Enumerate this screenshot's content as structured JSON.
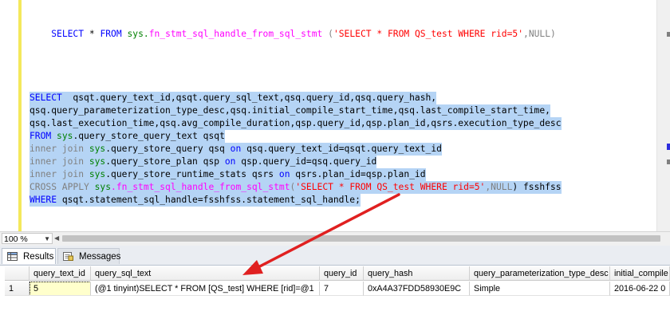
{
  "editor": {
    "line_top": {
      "kw_select": "SELECT",
      "star": " * ",
      "kw_from": "FROM",
      "sp": " ",
      "sys": "sys.",
      "fn": "fn_stmt_sql_handle_from_sql_stmt",
      "open": " (",
      "str": "'SELECT * FROM QS_test WHERE rid=5'",
      "comma": ",",
      "null": "NULL",
      "close": ")"
    },
    "query_lines": [
      {
        "a": "SELECT",
        "b": "  qsqt.query_text_id,qsqt.query_sql_text,qsq.query_id,qsq.query_hash,"
      },
      {
        "a": "",
        "b": "qsq.query_parameterization_type_desc,qsq.initial_compile_start_time,qsq.last_compile_start_time,"
      },
      {
        "a": "",
        "b": "qsq.last_execution_time,qsq.avg_compile_duration,qsp.query_id,qsp.plan_id,qsrs.execution_type_desc"
      },
      {
        "a": "FROM",
        "s": " sys",
        "b": ".query_store_query_text qsqt"
      },
      {
        "a": "inner join",
        "s": " sys",
        "b": ".query_store_query qsq ",
        "c": "on",
        "d": " qsq.query_text_id=qsqt.query_text_id"
      },
      {
        "a": "inner join",
        "s": " sys",
        "b": ".query_store_plan qsp ",
        "c": "on",
        "d": " qsp.query_id=qsq.query_id"
      },
      {
        "a": "inner join",
        "s": " sys",
        "b": ".query_store_runtime_stats qsrs ",
        "c": "on",
        "d": " qsrs.plan_id=qsp.plan_id"
      },
      {
        "a": "CROSS APPLY",
        "s": " sys",
        "f": ".fn_stmt_sql_handle_from_sql_stmt",
        "o": "(",
        "str": "'SELECT * FROM QS_test WHERE rid=5'",
        "e": ",",
        "n": "NULL",
        "t": ") fsshfss"
      },
      {
        "a": "WHERE",
        "b": " qsqt.statement_sql_handle=fsshfss.statement_sql_handle;"
      }
    ]
  },
  "zoom": {
    "value": "100 %"
  },
  "tabs": {
    "results": "Results",
    "messages": "Messages"
  },
  "grid": {
    "columns": [
      "query_text_id",
      "query_sql_text",
      "query_id",
      "query_hash",
      "query_parameterization_type_desc",
      "initial_compile"
    ],
    "rows": [
      {
        "num": "1",
        "cells": [
          "5",
          "(@1 tinyint)SELECT * FROM [QS_test] WHERE [rid]=@1",
          "7",
          "0xA4A37FDD58930E9C",
          "Simple",
          "2016-06-22 0"
        ]
      }
    ]
  },
  "colors": {
    "keyword": "#0000ff",
    "string": "#ff0000",
    "function": "#ff00ff",
    "selection": "#b5d4f5",
    "arrow": "#e02020"
  },
  "icons": [
    "results-grid-icon",
    "messages-icon",
    "zoom-dropdown-icon"
  ]
}
